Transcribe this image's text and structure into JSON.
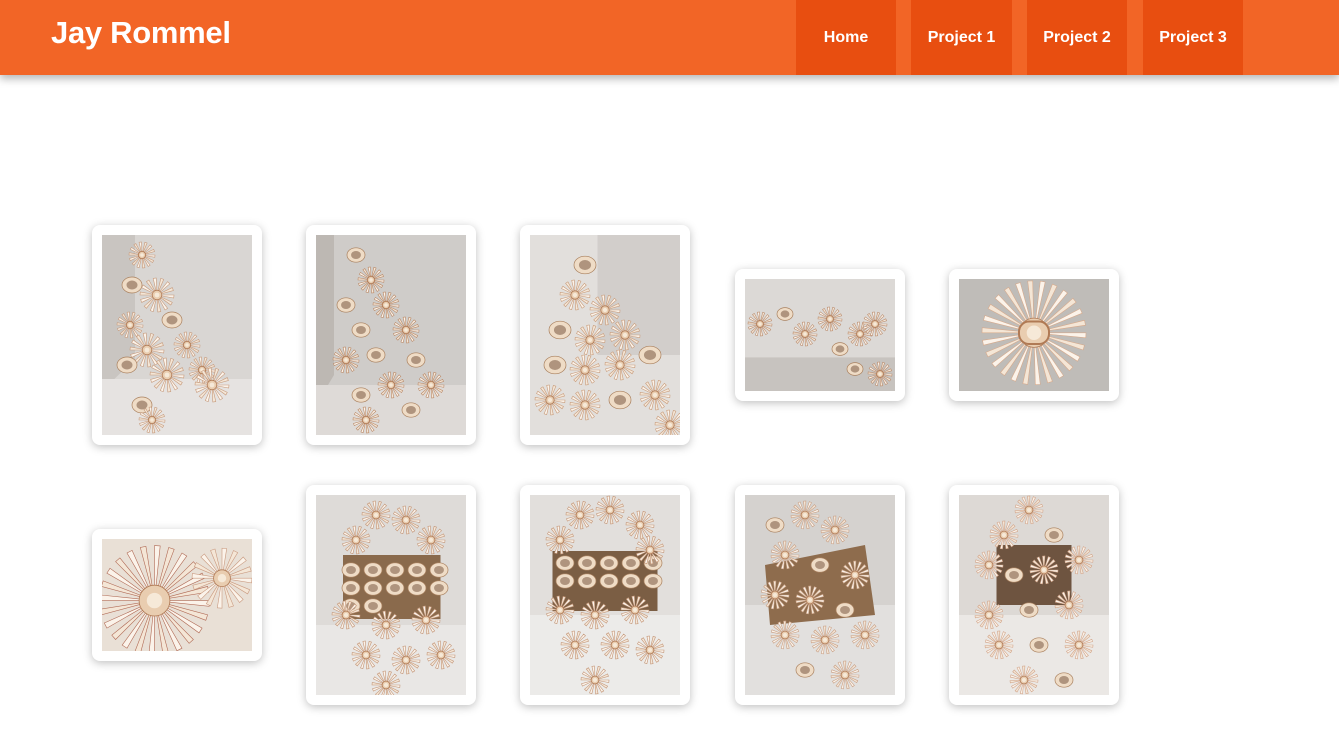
{
  "header": {
    "site_title": "Jay Rommel",
    "nav": [
      {
        "label": "Home"
      },
      {
        "label": "Project 1"
      },
      {
        "label": "Project 2"
      },
      {
        "label": "Project 3"
      }
    ]
  },
  "colors": {
    "header_bg": "#f26526",
    "nav_bg": "#e84e10",
    "text_on_accent": "#ffffff",
    "page_bg": "#ffffff"
  },
  "gallery": {
    "images": [
      {
        "subject": "paper flower sculpture in room corner",
        "orientation": "portrait"
      },
      {
        "subject": "paper flower sculpture in room corner",
        "orientation": "portrait"
      },
      {
        "subject": "paper flower sculpture close-up",
        "orientation": "portrait"
      },
      {
        "subject": "paper flower sculpture on wall",
        "orientation": "landscape"
      },
      {
        "subject": "single paper flower detail",
        "orientation": "landscape"
      },
      {
        "subject": "paper flower petals close-up",
        "orientation": "landscape"
      },
      {
        "subject": "paper flowers spilling from box",
        "orientation": "portrait"
      },
      {
        "subject": "paper flowers spilling from box",
        "orientation": "portrait"
      },
      {
        "subject": "paper flowers spilling from box",
        "orientation": "portrait"
      },
      {
        "subject": "paper flowers spilling from box",
        "orientation": "portrait"
      }
    ]
  }
}
